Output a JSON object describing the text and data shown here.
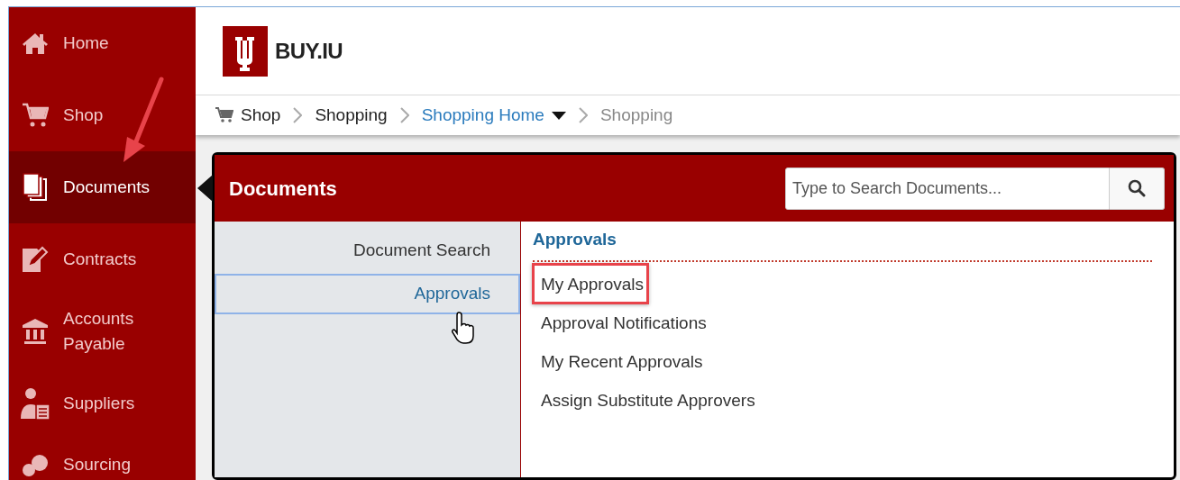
{
  "sidebar": {
    "items": [
      {
        "label": "Home",
        "selected": false
      },
      {
        "label": "Shop",
        "selected": false
      },
      {
        "label": "Documents",
        "selected": true
      },
      {
        "label": "Contracts",
        "selected": false
      },
      {
        "label": "Accounts Payable",
        "selected": false
      },
      {
        "label": "Suppliers",
        "selected": false
      },
      {
        "label": "Sourcing",
        "selected": false
      }
    ]
  },
  "header": {
    "logo_text": "BUY.IU"
  },
  "breadcrumb": [
    {
      "label": "Shop",
      "kind": "root"
    },
    {
      "label": "Shopping",
      "kind": "plain"
    },
    {
      "label": "Shopping Home",
      "kind": "dropdown"
    },
    {
      "label": "Shopping",
      "kind": "current"
    }
  ],
  "documents_panel": {
    "title": "Documents",
    "search": {
      "placeholder": "Type to Search Documents..."
    },
    "categories": [
      {
        "label": "Document Search",
        "selected": false
      },
      {
        "label": "Approvals",
        "selected": true
      }
    ],
    "section_title": "Approvals",
    "links": [
      {
        "label": "My Approvals",
        "highlighted": true
      },
      {
        "label": "Approval Notifications",
        "highlighted": false
      },
      {
        "label": "My Recent Approvals",
        "highlighted": false
      },
      {
        "label": "Assign Substitute Approvers",
        "highlighted": false
      }
    ]
  }
}
